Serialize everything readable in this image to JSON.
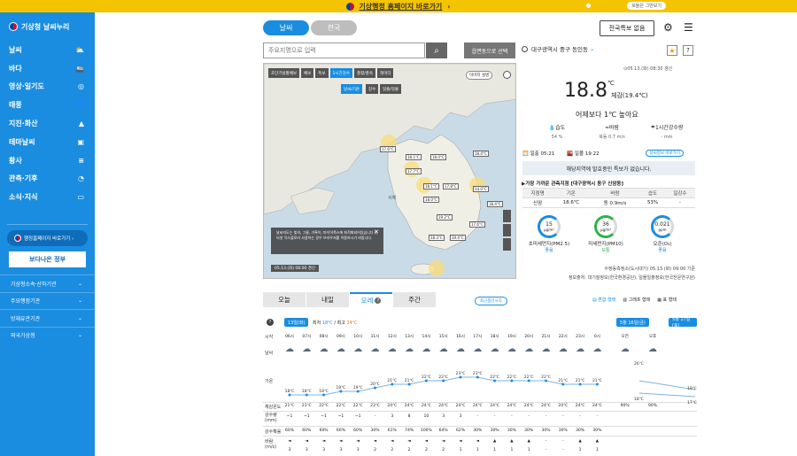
{
  "banner": {
    "title": "기상행정 홈페이지 바로가기",
    "chev": "›",
    "small": "모들은 그만보기"
  },
  "sidebar": {
    "logo": "기상청 날씨누리",
    "items": [
      {
        "label": "날씨",
        "icon": "⛅"
      },
      {
        "label": "바다",
        "icon": "🚢"
      },
      {
        "label": "영상·일기도",
        "icon": "◎"
      },
      {
        "label": "태풍",
        "icon": "🌀"
      },
      {
        "label": "지진·화산",
        "icon": "▲"
      },
      {
        "label": "테마날씨",
        "icon": "▣"
      },
      {
        "label": "황사",
        "icon": "≡"
      },
      {
        "label": "관측·기후",
        "icon": "◔"
      },
      {
        "label": "소식·지식",
        "icon": "▭"
      }
    ],
    "gov_button": "행정홈페이지 바로가기 ›",
    "banner_ad": "보다나은 정부",
    "sub": [
      {
        "label": "기상청소속·산하기관",
        "icon": "⌄"
      },
      {
        "label": "주요행정기관",
        "icon": "⌄"
      },
      {
        "label": "방재유관기관",
        "icon": "⌄"
      },
      {
        "label": "외국기상청",
        "icon": "⌄"
      }
    ]
  },
  "header": {
    "tab_weather": "날씨",
    "tab_national": "전국",
    "warn_button": "전국특보 없음",
    "gear": "⚙",
    "menu": "☰"
  },
  "search": {
    "placeholder": "주요지명으로 입력",
    "icon": "⌕",
    "map_button": "읍면동으로 선택"
  },
  "location": {
    "name": "대구광역시 중구 동인동",
    "chev": "⌄",
    "star": "★",
    "help": "?"
  },
  "map": {
    "tools": [
      "초단기실황예보",
      "예보",
      "특보",
      "1시간강수",
      "풍향/풍속",
      "레이더"
    ],
    "tools2": [
      "날씨/기온",
      "강수",
      "일출/일몰"
    ],
    "guide": "이미지 설명",
    "popup": "날씨지도는 빛의, 그물, 기록이, 파이어폭스에 최적화되어있습니다 인터넷 익스플로러 사용하는 경우 브라우저를 이용하시기 바랍니다.",
    "close": "✕",
    "time": "05.13.(화) 08:00 경신",
    "sea": "서해",
    "labels": [
      "17.6°C",
      "18.4°C",
      "18.1°C",
      "18.0°C",
      "17.7°C",
      "18.1°C",
      "17.8°C",
      "18.0°C",
      "14.0°C",
      "19.2°C",
      "18.4°C",
      "18.3°C",
      "19.4°C",
      "17.6°C"
    ]
  },
  "current": {
    "updated": "⊙05.13.(화) 08:30 갱신",
    "temp": "18.8",
    "unit": "℃",
    "feels": "체감(19.4℃)",
    "compare": "어제보다 1℃ 높아요",
    "humidity_label": "💧습도",
    "humidity": "54 %",
    "wind_label": "≈바람",
    "wind": "북동 0.7 m/s",
    "rain_label": "☂1시간강수량",
    "rain": "- mm",
    "sunrise": "🌅 일출 05:21",
    "sunset": "🌇 일몰 19:22",
    "night_btn": "날씨정보 바로가기",
    "alert": "해당지역에 발효중인 특보가 없습니다."
  },
  "obs": {
    "title": "▶가장 가까운 관측지점 [대구광역시 동구 신암동]",
    "headers": [
      "지점명",
      "기온",
      "바람",
      "습도",
      "일강수"
    ],
    "row": [
      "신암",
      "18.6℃",
      "동 0.9m/s",
      "53%",
      "-"
    ]
  },
  "gauges": [
    {
      "value": "15",
      "unit": "μg/m³",
      "label": "초미세먼지(PM2.5)",
      "status": "좋음",
      "ring": "#1a8de0",
      "pct": 0.3
    },
    {
      "value": "36",
      "unit": "μg/m³",
      "label": "미세먼지(PM10)",
      "status": "보통",
      "ring": "#2db34a",
      "pct": 0.45
    },
    {
      "value": "0.021",
      "unit": "ppm",
      "label": "오존(O₃)",
      "status": "좋음",
      "ring": "#1a8de0",
      "pct": 0.2
    }
  ],
  "sources": {
    "line1": "수정동측정소(도시대기) 05.13.(화) 09:00 기준",
    "line2": "정보출처: 대기질정보(한국환경공단), 일몰일출정보(한국천문연구원)"
  },
  "forecast": {
    "tabs": [
      "오늘",
      "내일",
      "모레",
      "주간"
    ],
    "tab_q": "?",
    "pill": "최근갱신시각",
    "views": [
      "▤ 혼합 형태",
      "▥ 그래프 형태",
      "▦ 표 형태"
    ],
    "day1": "13일(화)",
    "min_label": "최저",
    "min": "18℃",
    "sep": " / 최고",
    "max": "24℃",
    "day2": "5월 16일(금)",
    "day3": "5월 17일(토)",
    "row_labels": [
      "시각",
      "날씨",
      "기온",
      "체감온도",
      "강수량(mm)",
      "강수확률",
      "바람(m/s)"
    ],
    "hours": [
      "06시",
      "07시",
      "08시",
      "09시",
      "10시",
      "11시",
      "12시",
      "13시",
      "14시",
      "15시",
      "16시",
      "17시",
      "18시",
      "19시",
      "20시",
      "21시",
      "22시",
      "23시",
      "0시",
      "오전",
      "오후"
    ],
    "temps": [
      "18℃",
      "18℃",
      "18℃",
      "19℃",
      "19℃",
      "20℃",
      "21℃",
      "21℃",
      "22℃",
      "22℃",
      "23℃",
      "23℃",
      "22℃",
      "22℃",
      "22℃",
      "22℃",
      "21℃",
      "21℃",
      "21℃"
    ],
    "feels": [
      "21℃",
      "21℃",
      "22℃",
      "22℃",
      "22℃",
      "23℃",
      "24℃",
      "24℃",
      "24℃",
      "24℃",
      "24℃",
      "24℃",
      "24℃",
      "24℃",
      "24℃",
      "24℃",
      "24℃",
      "24℃",
      "24℃",
      "90%",
      "90%"
    ],
    "rain": [
      "~1",
      "~1",
      "~1",
      "~1",
      "~1",
      "-",
      "3",
      "8",
      "10",
      "3",
      "3",
      "-",
      "-",
      "-",
      "-",
      "-",
      "-",
      "-",
      "-"
    ],
    "pop": [
      "60%",
      "60%",
      "60%",
      "60%",
      "60%",
      "30%",
      "61%",
      "74%",
      "100%",
      "64%",
      "62%",
      "30%",
      "30%",
      "30%",
      "30%",
      "30%",
      "30%",
      "30%",
      "30%"
    ],
    "wind": [
      "◄",
      "◄",
      "◄",
      "◄",
      "◄",
      "◄",
      "◄",
      "◄",
      "◄",
      "◄",
      "◄",
      "◄",
      "▲",
      "▲",
      "▲",
      "-",
      "-",
      "▲",
      "▲"
    ],
    "wind_v": [
      "3",
      "3",
      "3",
      "3",
      "3",
      "2",
      "2",
      "2",
      "2",
      "2",
      "1",
      "1",
      "1",
      "1",
      "1",
      "-",
      "-",
      "1",
      "1"
    ],
    "right_temps": [
      "26℃",
      "18℃",
      "19℃",
      "17℃"
    ]
  }
}
